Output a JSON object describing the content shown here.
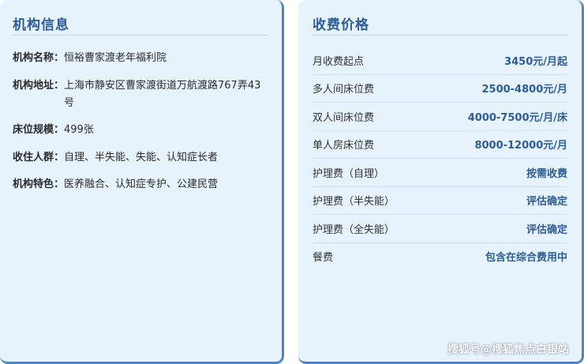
{
  "institution": {
    "title": "机构信息",
    "rows": [
      {
        "key": "机构名称：",
        "value": "恒裕曹家渡老年福利院"
      },
      {
        "key": "机构地址：",
        "value": "上海市静安区曹家渡街道万航渡路767弄43号"
      },
      {
        "key": "床位规模：",
        "value": "499张"
      },
      {
        "key": "收住人群：",
        "value": "自理、半失能、失能、认知症长者"
      },
      {
        "key": "机构特色：",
        "value": "医养融合、认知症专护、公建民营"
      }
    ]
  },
  "pricing": {
    "title": "收费价格",
    "rows": [
      {
        "item": "月收费起点",
        "value": "3450元/月起"
      },
      {
        "item": "多人间床位费",
        "value": "2500-4800元/月"
      },
      {
        "item": "双人间床位费",
        "value": "4000-7500元/月/床"
      },
      {
        "item": "单人房床位费",
        "value": "8000-12000元/月"
      },
      {
        "item": "护理费（自理）",
        "value": "按需收费"
      },
      {
        "item": "护理费（半失能）",
        "value": "评估确定"
      },
      {
        "item": "护理费（全失能）",
        "value": "评估确定"
      },
      {
        "item": "餐费",
        "value": "包含在综合费用中"
      }
    ]
  },
  "watermark": "搜狐号@搜狐焦点白银站",
  "colors": {
    "accent": "#2d5d98",
    "card_bg": "#e6f2fc",
    "border": "#4a86c8"
  }
}
